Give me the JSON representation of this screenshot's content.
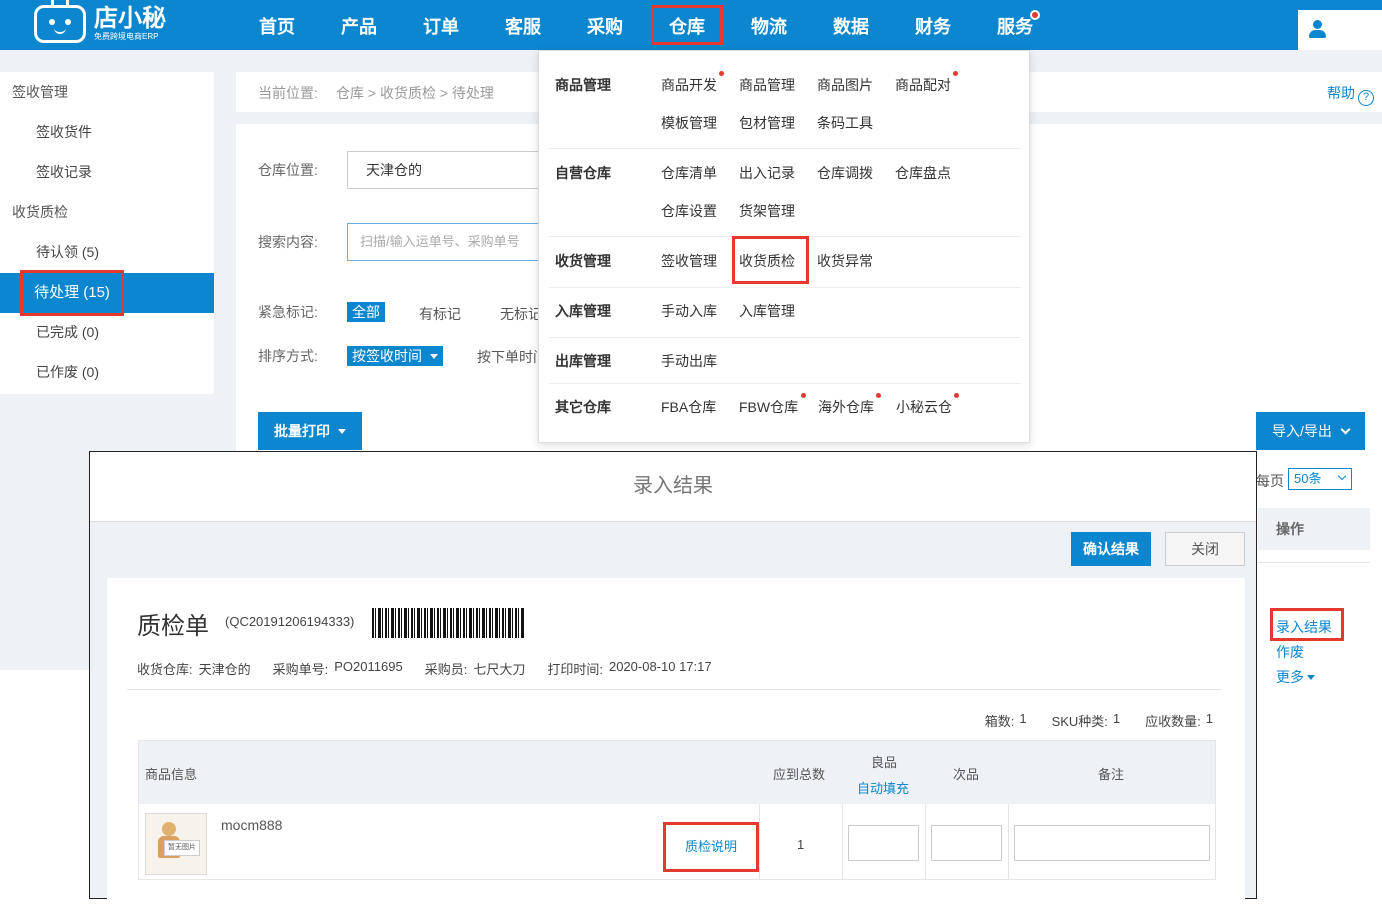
{
  "brand": {
    "name": "店小秘",
    "tagline": "免费跨境电商ERP"
  },
  "nav": {
    "items": [
      "首页",
      "产品",
      "订单",
      "客服",
      "采购",
      "仓库",
      "物流",
      "数据",
      "财务",
      "服务"
    ],
    "active": "仓库"
  },
  "sidebar": {
    "group1": "签收管理",
    "item_receive": "签收货件",
    "item_records": "签收记录",
    "group2": "收货质检",
    "item_pending_claim": "待认领 (5)",
    "item_pending": "待处理 (15)",
    "item_done": "已完成 (0)",
    "item_void": "已作废 (0)"
  },
  "breadcrumb": {
    "label": "当前位置:",
    "path": "仓库 > 收货质检 > 待处理"
  },
  "help": "帮助",
  "filters": {
    "warehouse_label": "仓库位置:",
    "warehouse_value": "天津仓的",
    "search_label": "搜索内容:",
    "search_placeholder": "扫描/输入运单号、采购单号",
    "urgent_label": "紧急标记:",
    "urgent_all": "全部",
    "urgent_marked": "有标记",
    "urgent_unmarked": "无标记",
    "sort_label": "排序方式:",
    "sort_active": "按签收时间",
    "sort_other": "按下单时间"
  },
  "toolbar": {
    "batch_print": "批量打印",
    "import_export": "导入/导出",
    "per_page_label": "每页",
    "per_page_value": "50条"
  },
  "operations": {
    "header": "操作",
    "enter_result": "录入结果",
    "void": "作废",
    "more": "更多"
  },
  "dropdown": {
    "groups": [
      {
        "name": "商品管理",
        "rows": [
          [
            "商品开发",
            "商品管理",
            "商品图片",
            "商品配对"
          ],
          [
            "模板管理",
            "包材管理",
            "条码工具"
          ]
        ]
      },
      {
        "name": "自营仓库",
        "rows": [
          [
            "仓库清单",
            "出入记录",
            "仓库调拨",
            "仓库盘点"
          ],
          [
            "仓库设置",
            "货架管理"
          ]
        ]
      },
      {
        "name": "收货管理",
        "rows": [
          [
            "签收管理",
            "收货质检",
            "收货异常"
          ]
        ]
      },
      {
        "name": "入库管理",
        "rows": [
          [
            "手动入库",
            "入库管理"
          ]
        ]
      },
      {
        "name": "出库管理",
        "rows": [
          [
            "手动出库"
          ]
        ]
      },
      {
        "name": "其它仓库",
        "rows": [
          [
            "FBA仓库",
            "FBW仓库",
            "海外仓库",
            "小秘云仓"
          ]
        ]
      }
    ]
  },
  "modal": {
    "title": "录入结果",
    "confirm": "确认结果",
    "close": "关闭",
    "sheet_title": "质检单",
    "sheet_no": "(QC20191206194333)",
    "warehouse_label": "收货仓库:",
    "warehouse": "天津仓的",
    "po_label": "采购单号:",
    "po": "PO2011695",
    "buyer_label": "采购员:",
    "buyer": "七尺大刀",
    "print_time_label": "打印时间:",
    "print_time": "2020-08-10 17:17",
    "boxes_label": "箱数:",
    "boxes": "1",
    "sku_types_label": "SKU种类:",
    "sku_types": "1",
    "expected_label": "应收数量:",
    "expected": "1",
    "table": {
      "col_product": "商品信息",
      "col_total": "应到总数",
      "col_good": "良品",
      "col_autofill": "自动填充",
      "col_defective": "次品",
      "col_remark": "备注"
    },
    "row": {
      "sku": "mocm888",
      "no_image": "暂无图片",
      "qc_note": "质检说明",
      "total": "1"
    }
  }
}
